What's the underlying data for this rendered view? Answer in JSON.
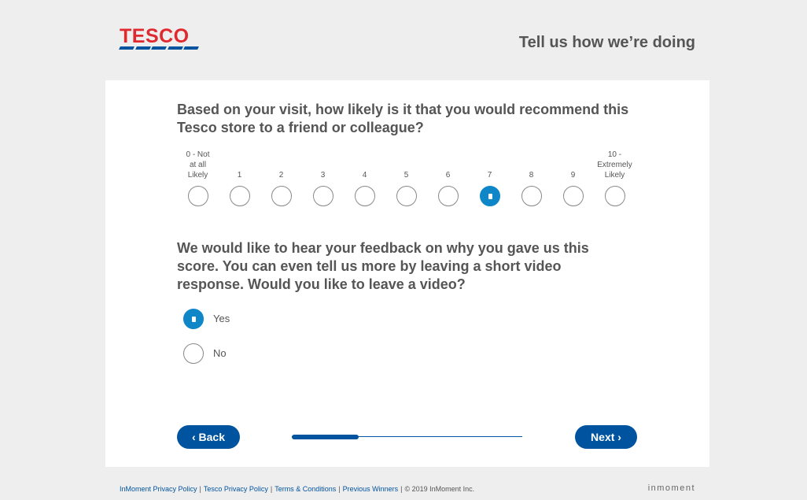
{
  "brand": {
    "logo_text": "TESCO",
    "primary_color": "#00539f",
    "logo_color": "#e0282f"
  },
  "header": {
    "title": "Tell us how we’re doing"
  },
  "question1": {
    "text": "Based on your visit, how likely is it that you would recommend this Tesco store to a friend or colleague?",
    "scale": [
      {
        "label": "0 - Not at all Likely",
        "lines": [
          "0 - Not",
          "at all",
          "Likely"
        ]
      },
      {
        "label": "1",
        "lines": [
          "1"
        ]
      },
      {
        "label": "2",
        "lines": [
          "2"
        ]
      },
      {
        "label": "3",
        "lines": [
          "3"
        ]
      },
      {
        "label": "4",
        "lines": [
          "4"
        ]
      },
      {
        "label": "5",
        "lines": [
          "5"
        ]
      },
      {
        "label": "6",
        "lines": [
          "6"
        ]
      },
      {
        "label": "7",
        "lines": [
          "7"
        ]
      },
      {
        "label": "8",
        "lines": [
          "8"
        ]
      },
      {
        "label": "9",
        "lines": [
          "9"
        ]
      },
      {
        "label": "10 - Extremely Likely",
        "lines": [
          "10 -",
          "Extremely",
          "Likely"
        ]
      }
    ],
    "selected_index": 7
  },
  "question2": {
    "text": "We would like to hear your feedback on why you gave us this score. You can even tell us more by leaving a short video response. Would you like to leave a video?",
    "options": [
      {
        "label": "Yes",
        "selected": true
      },
      {
        "label": "No",
        "selected": false
      }
    ]
  },
  "nav": {
    "back_label": "‹ Back",
    "next_label": "Next ›",
    "progress": 0.29
  },
  "footer": {
    "links": [
      "InMoment Privacy Policy",
      "Tesco Privacy Policy",
      "Terms & Conditions",
      "Previous Winners"
    ],
    "copyright": "© 2019 InMoment Inc.",
    "separator": "|",
    "vendor": "inmoment"
  }
}
